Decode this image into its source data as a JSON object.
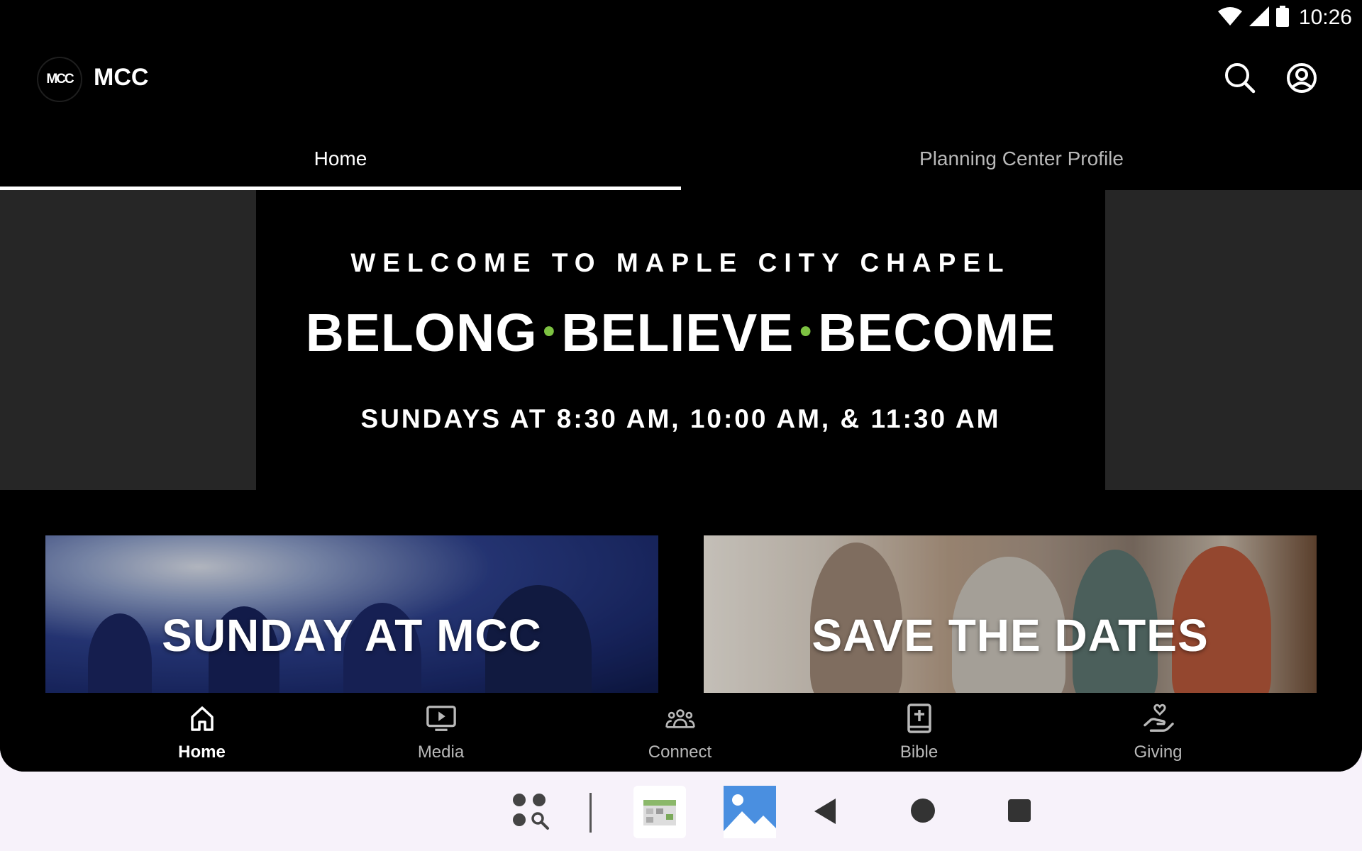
{
  "status_bar": {
    "time": "10:26"
  },
  "app": {
    "logo_text": "MCC",
    "title": "MCC"
  },
  "tabs": [
    {
      "label": "Home",
      "active": true
    },
    {
      "label": "Planning Center Profile",
      "active": false
    }
  ],
  "hero": {
    "welcome": "WELCOME TO MAPLE CITY CHAPEL",
    "tagline_1": "BELONG",
    "tagline_2": "BELIEVE",
    "tagline_3": "BECOME",
    "separator": "•",
    "times": "SUNDAYS AT 8:30 AM, 10:00 AM, & 11:30 AM",
    "accent_color": "#7dc242"
  },
  "cards": [
    {
      "title": "SUNDAY AT MCC"
    },
    {
      "title": "SAVE THE DATES"
    }
  ],
  "bottom_nav": [
    {
      "label": "Home",
      "icon": "home-icon",
      "active": true
    },
    {
      "label": "Media",
      "icon": "media-icon",
      "active": false
    },
    {
      "label": "Connect",
      "icon": "connect-icon",
      "active": false
    },
    {
      "label": "Bible",
      "icon": "bible-icon",
      "active": false
    },
    {
      "label": "Giving",
      "icon": "giving-icon",
      "active": false
    }
  ],
  "system_nav": [
    "app-drawer-icon",
    "calendar-app-icon",
    "gallery-app-icon",
    "back-icon",
    "home-circle-icon",
    "recents-icon"
  ]
}
